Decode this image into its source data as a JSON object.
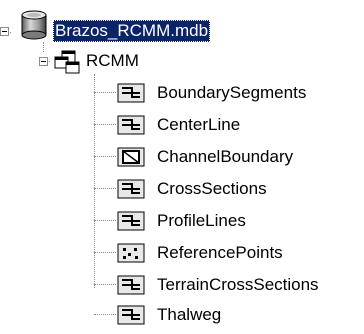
{
  "tree": {
    "database": {
      "label": "Brazos_RCMM.mdb",
      "icon": "database-cylinder-icon",
      "selected": true,
      "colors": {
        "selection_bg": "#0a246a",
        "selection_fg": "#ffffff"
      }
    },
    "dataset": {
      "label": "RCMM",
      "icon": "feature-dataset-icon"
    },
    "items": [
      {
        "label": "BoundarySegments",
        "icon": "line-feature-class-icon"
      },
      {
        "label": "CenterLine",
        "icon": "line-feature-class-icon"
      },
      {
        "label": "ChannelBoundary",
        "icon": "polygon-feature-class-icon"
      },
      {
        "label": "CrossSections",
        "icon": "line-feature-class-icon"
      },
      {
        "label": "ProfileLines",
        "icon": "line-feature-class-icon"
      },
      {
        "label": "ReferencePoints",
        "icon": "point-feature-class-icon"
      },
      {
        "label": "TerrainCrossSections",
        "icon": "line-feature-class-icon"
      },
      {
        "label": "Thalweg",
        "icon": "line-feature-class-icon"
      }
    ]
  }
}
